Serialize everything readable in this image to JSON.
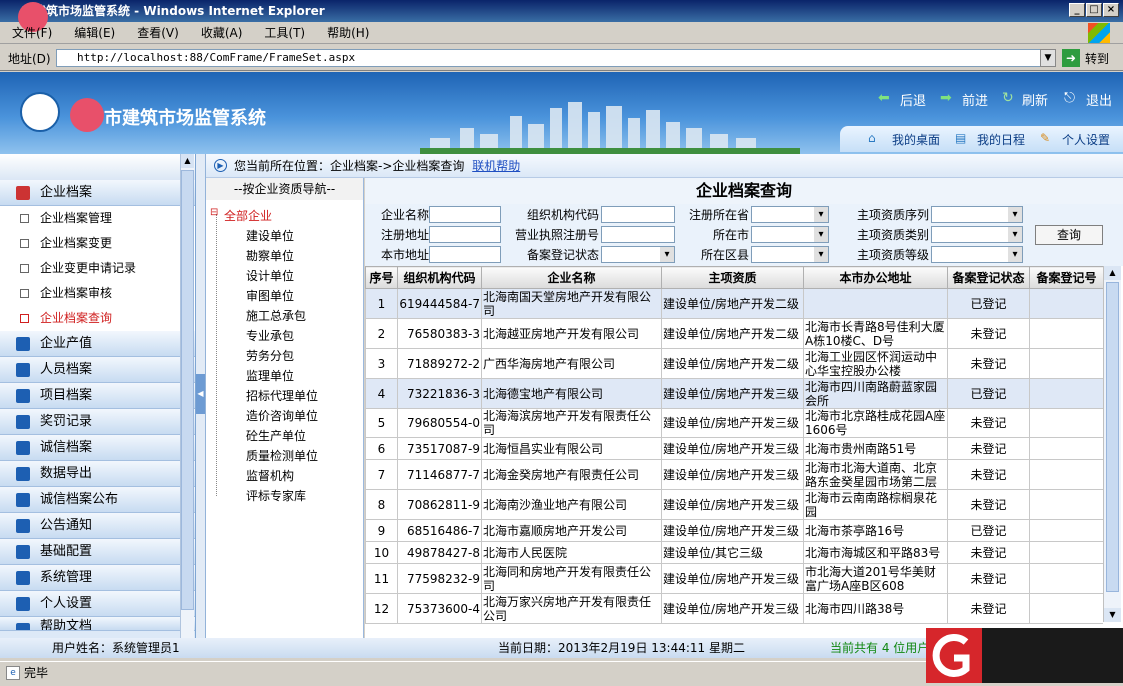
{
  "window": {
    "title": "市建筑市场监管系统 - Windows Internet Explorer"
  },
  "menu": [
    "文件(F)",
    "编辑(E)",
    "查看(V)",
    "收藏(A)",
    "工具(T)",
    "帮助(H)"
  ],
  "address": {
    "label": "地址(D)",
    "url": "http://localhost:88/ComFrame/FrameSet.aspx",
    "go": "转到"
  },
  "app": {
    "title": "市建筑市场监管系统",
    "nav": {
      "back": "后退",
      "forward": "前进",
      "refresh": "刷新",
      "exit": "退出"
    },
    "tabs": {
      "desktop": "我的桌面",
      "schedule": "我的日程",
      "settings": "个人设置"
    }
  },
  "sidebar": {
    "archive": "企业档案",
    "archive_items": [
      "企业档案管理",
      "企业档案变更",
      "企业变更申请记录",
      "企业档案审核",
      "企业档案查询"
    ],
    "sections": [
      "企业产值",
      "人员档案",
      "项目档案",
      "奖罚记录",
      "诚信档案",
      "数据导出",
      "诚信档案公布",
      "公告通知",
      "基础配置",
      "系统管理",
      "个人设置",
      "帮助文档"
    ]
  },
  "breadcrumb": {
    "text": "您当前所在位置：企业档案->企业档案查询",
    "help": "联机帮助"
  },
  "tree": {
    "header": "--按企业资质导航--",
    "root": "全部企业",
    "nodes": [
      "建设单位",
      "勘察单位",
      "设计单位",
      "审图单位",
      "施工总承包",
      "专业承包",
      "劳务分包",
      "监理单位",
      "招标代理单位",
      "造价咨询单位",
      "砼生产单位",
      "质量检测单位",
      "监督机构",
      "评标专家库"
    ]
  },
  "page": {
    "title": "企业档案查询"
  },
  "form": {
    "name": "企业名称",
    "org_code": "组织机构代码",
    "reg_province": "注册所在省",
    "main_qual_seq": "主项资质序列",
    "reg_addr": "注册地址",
    "license_no": "营业执照注册号",
    "city": "所在市",
    "main_qual_type": "主项资质类别",
    "local_addr": "本市地址",
    "record_status": "备案登记状态",
    "district": "所在区县",
    "main_qual_level": "主项资质等级",
    "query": "查询"
  },
  "table": {
    "headers": [
      "序号",
      "组织机构代码",
      "企业名称",
      "主项资质",
      "本市办公地址",
      "备案登记状态",
      "备案登记号"
    ],
    "rows": [
      [
        "1",
        "619444584-7",
        "北海南国天堂房地产开发有限公司",
        "建设单位/房地产开发二级",
        "",
        "已登记",
        ""
      ],
      [
        "2",
        "76580383-3",
        "北海越亚房地产开发有限公司",
        "建设单位/房地产开发二级",
        "北海市长青路8号佳利大厦A栋10楼C、D号",
        "未登记",
        ""
      ],
      [
        "3",
        "71889272-2",
        "广西华海房地产有限公司",
        "建设单位/房地产开发二级",
        "北海工业园区怀润运动中心华宝控股办公楼",
        "未登记",
        ""
      ],
      [
        "4",
        "73221836-3",
        "北海德宝地产有限公司",
        "建设单位/房地产开发三级",
        "北海市四川南路蔚蓝家园会所",
        "已登记",
        ""
      ],
      [
        "5",
        "79680554-0",
        "北海海滨房地产开发有限责任公司",
        "建设单位/房地产开发三级",
        "北海市北京路桂成花园A座1606号",
        "未登记",
        ""
      ],
      [
        "6",
        "73517087-9",
        "北海恒昌实业有限公司",
        "建设单位/房地产开发三级",
        "北海市贵州南路51号",
        "未登记",
        ""
      ],
      [
        "7",
        "71146877-7",
        "北海金癸房地产有限责任公司",
        "建设单位/房地产开发三级",
        "北海市北海大道南、北京路东金癸星园市场第二层",
        "未登记",
        ""
      ],
      [
        "8",
        "70862811-9",
        "北海南沙渔业地产有限公司",
        "建设单位/房地产开发三级",
        "北海市云南南路棕榈泉花园",
        "未登记",
        ""
      ],
      [
        "9",
        "68516486-7",
        "北海市嘉顺房地产开发公司",
        "建设单位/房地产开发三级",
        "北海市茶亭路16号",
        "已登记",
        ""
      ],
      [
        "10",
        "49878427-8",
        "北海市人民医院",
        "建设单位/其它三级",
        "北海市海城区和平路83号",
        "未登记",
        ""
      ],
      [
        "11",
        "77598232-9",
        "北海同和房地产开发有限责任公司",
        "建设单位/房地产开发三级",
        "市北海大道201号华美财富广场A座B区608",
        "未登记",
        ""
      ],
      [
        "12",
        "75373600-4",
        "北海万家兴房地产开发有限责任公司",
        "建设单位/房地产开发三级",
        "北海市四川路38号",
        "未登记",
        ""
      ]
    ]
  },
  "status": {
    "user": "用户姓名：系统管理员1",
    "date": "当前日期：2013年2月19日 13:44:11 星期二",
    "online": "当前共有 4 位用户"
  },
  "ie_status": "完毕"
}
